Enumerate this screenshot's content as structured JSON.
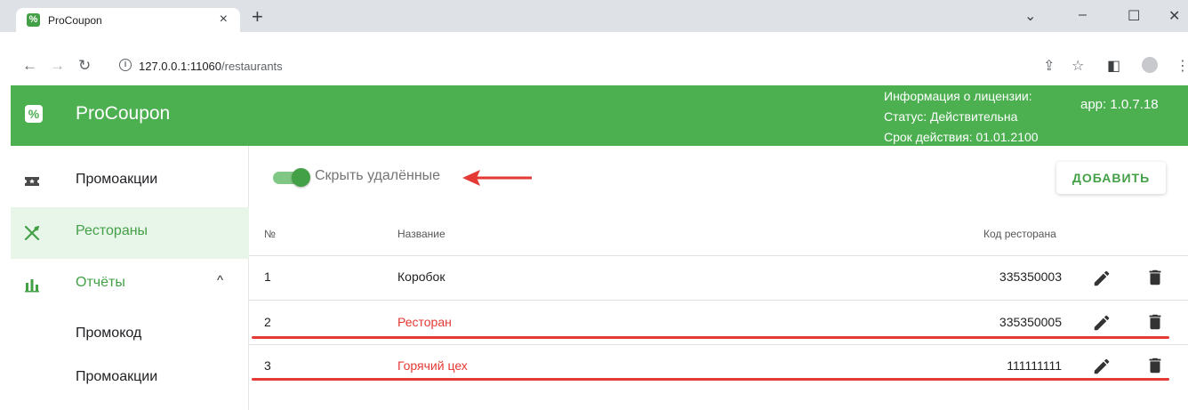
{
  "browser": {
    "tab_title": "ProCoupon",
    "tab_close": "×",
    "new_tab": "+",
    "url_host": "127.0.0.1:11060",
    "url_path": "/restaurants",
    "minimize": "–",
    "maximize": "☐",
    "close": "✕",
    "collapse": "⌄"
  },
  "header": {
    "app_title": "ProCoupon",
    "license_heading": "Информация о лицензии:",
    "license_status": "Статус: Действительна",
    "license_expiry": "Срок действия: 01.01.2100",
    "app_version": "app: 1.0.7.18"
  },
  "sidebar": {
    "items": [
      {
        "label": "Промоакции",
        "icon": "ticket-icon"
      },
      {
        "label": "Рестораны",
        "icon": "utensils-icon",
        "active": true
      },
      {
        "label": "Отчёты",
        "icon": "bar-chart-icon",
        "expanded": true
      }
    ],
    "subitems": [
      {
        "label": "Промокод"
      },
      {
        "label": "Промоакции"
      }
    ]
  },
  "main": {
    "toggle_label": "Скрыть удалённые",
    "toggle_on": true,
    "add_button": "ДОБАВИТЬ",
    "columns": {
      "num": "№",
      "name": "Название",
      "code": "Код ресторана"
    },
    "rows": [
      {
        "num": "1",
        "name": "Коробок",
        "code": "335350003",
        "deleted": false
      },
      {
        "num": "2",
        "name": "Ресторан",
        "code": "335350005",
        "deleted": true
      },
      {
        "num": "3",
        "name": "Горячий цех",
        "code": "111111111",
        "deleted": true
      }
    ]
  },
  "colors": {
    "brand_green": "#4caf50",
    "accent_green": "#43a047",
    "deleted_red": "#e53935",
    "annotation_red": "#e53935"
  }
}
